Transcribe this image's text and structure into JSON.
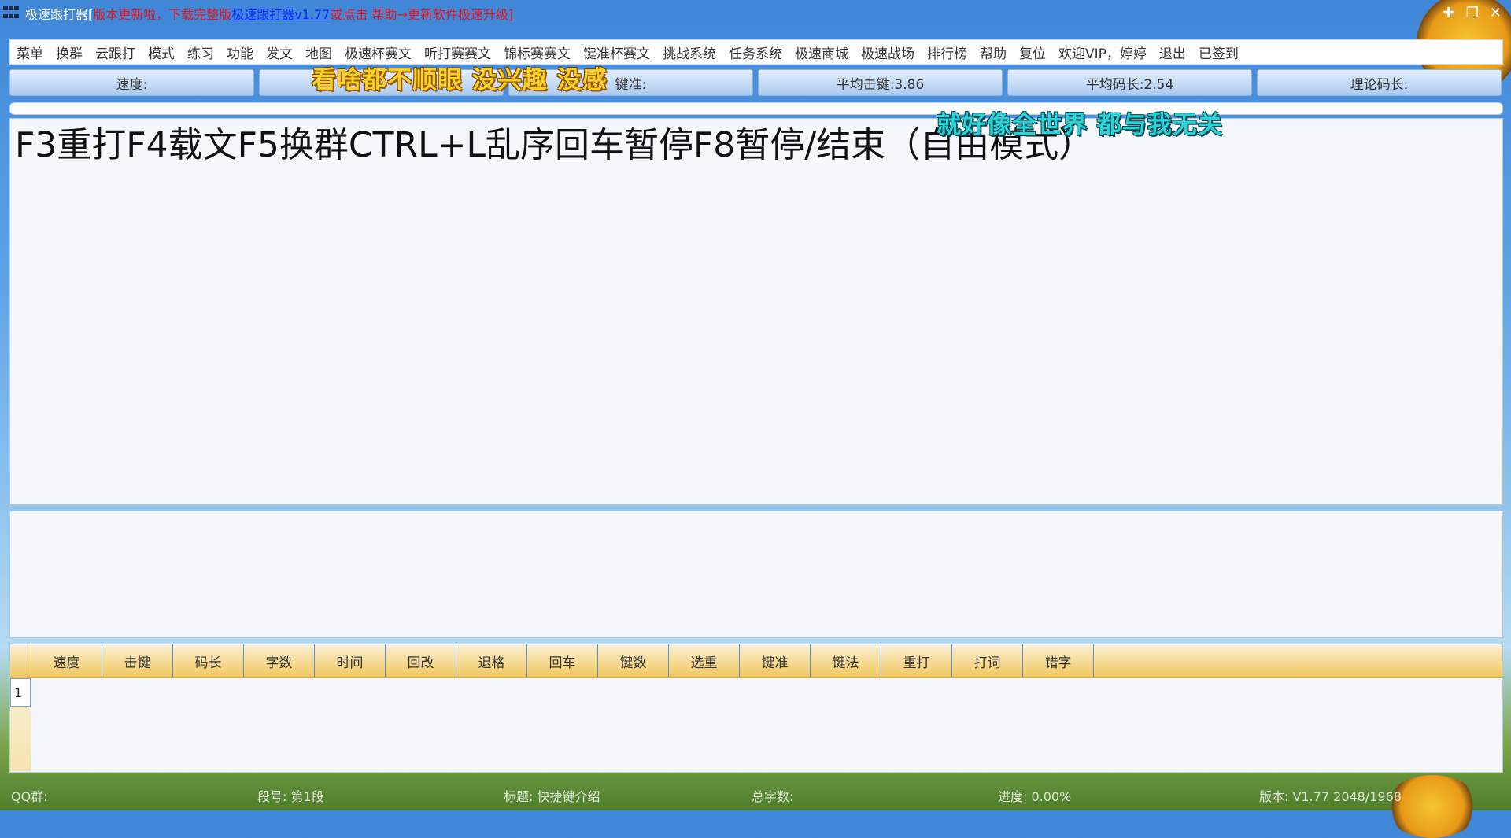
{
  "titlebar": {
    "app_name": "极速跟打器[",
    "update_text": "版本更新啦，下载完整版 ",
    "link_text": "极速跟打器v1.77",
    "tail_text": " 或点击 帮助→更新软件极速升级]"
  },
  "menu": [
    "菜单",
    "换群",
    "云跟打",
    "模式",
    "练习",
    "功能",
    "发文",
    "地图",
    "极速杯赛文",
    "听打赛赛文",
    "锦标赛赛文",
    "键准杯赛文",
    "挑战系统",
    "任务系统",
    "极速商城",
    "极速战场",
    "排行榜",
    "帮助",
    "复位",
    "欢迎VIP，婷婷",
    "退出",
    "已签到"
  ],
  "stats": [
    "速度:",
    "",
    "键准:",
    "平均击键:3.86",
    "平均码长:2.54",
    "理论码长:"
  ],
  "overlay_lyric_1": "看啥都不顺眼 没兴趣 没感",
  "overlay_lyric_2": "就好像全世界 都与我无关",
  "text_content": "F3重打F4载文F5换群CTRL+L乱序回车暂停F8暂停/结束（自由模式）",
  "table": {
    "headers": [
      "速度",
      "击键",
      "码长",
      "字数",
      "时间",
      "回改",
      "退格",
      "回车",
      "键数",
      "选重",
      "键准",
      "键法",
      "重打",
      "打词",
      "错字"
    ],
    "rows": [
      "1"
    ]
  },
  "status": {
    "qq_group": "QQ群:",
    "segment": "段号: 第1段",
    "label": "标题: 快捷键介绍",
    "total": "总字数:",
    "progress": "进度: 0.00%",
    "version": "版本: V1.77 2048/1968"
  }
}
